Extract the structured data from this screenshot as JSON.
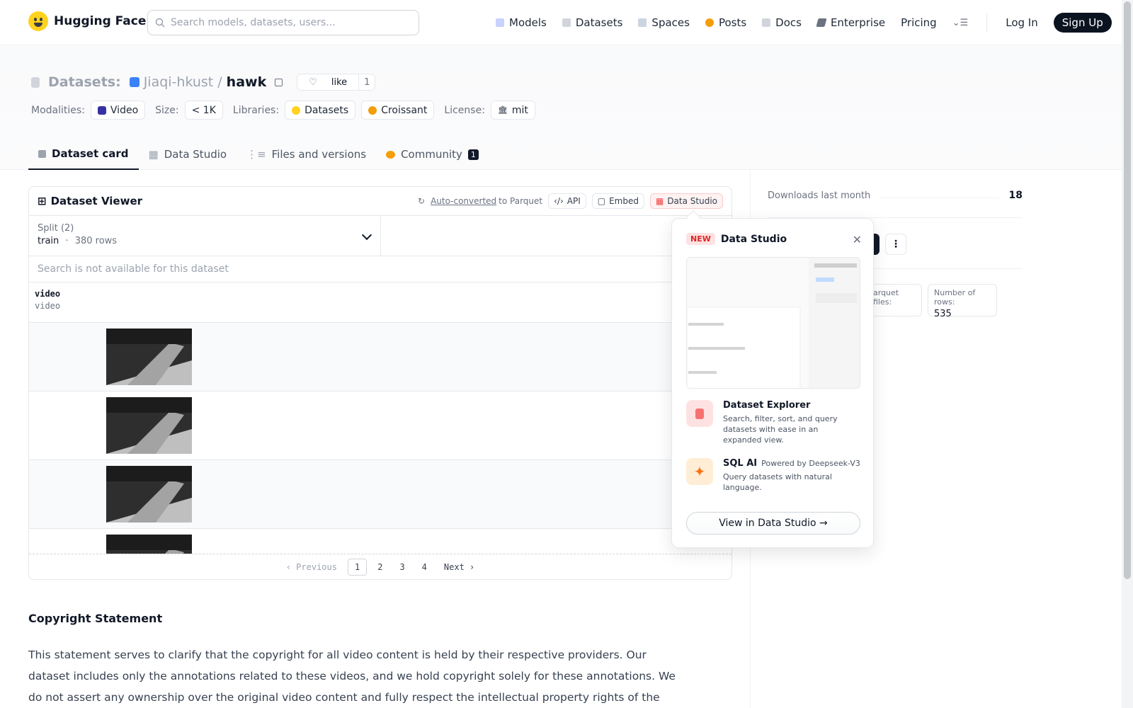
{
  "nav": {
    "brand": "Hugging Face",
    "search_placeholder": "Search models, datasets, users...",
    "links": [
      "Models",
      "Datasets",
      "Spaces",
      "Posts",
      "Docs",
      "Enterprise",
      "Pricing"
    ],
    "login": "Log In",
    "signup": "Sign Up"
  },
  "repo": {
    "kind": "Datasets:",
    "owner": "Jiaqi-hkust",
    "slash": "/",
    "name": "hawk",
    "like_label": "like",
    "like_count": "1"
  },
  "meta": {
    "modalities_label": "Modalities:",
    "modality": "Video",
    "size_label": "Size:",
    "size": "< 1K",
    "libraries_label": "Libraries:",
    "libraries": [
      "Datasets",
      "Croissant"
    ],
    "license_label": "License:",
    "license": "mit"
  },
  "tabs": [
    {
      "label": "Dataset card"
    },
    {
      "label": "Data Studio"
    },
    {
      "label": "Files and versions"
    },
    {
      "label": "Community",
      "badge": "1"
    }
  ],
  "viewer": {
    "title": "Dataset Viewer",
    "auto_converted": "Auto-converted",
    "to_parquet": "to Parquet",
    "api": "API",
    "embed": "Embed",
    "data_studio": "Data Studio",
    "split_label": "Split (2)",
    "split_name": "train",
    "split_dot": "·",
    "split_rows": "380 rows",
    "search_unavailable": "Search is not available for this dataset",
    "column_name": "video",
    "column_type": "video",
    "pager": {
      "previous": "Previous",
      "pages": [
        "1",
        "2",
        "3",
        "4"
      ],
      "current": "1",
      "next": "Next"
    }
  },
  "sidebar": {
    "downloads_label": "Downloads last month",
    "downloads_value": "18",
    "parquet_label": "arquet files:",
    "rows_label": "Number of rows:",
    "rows_value": "535"
  },
  "popover": {
    "new_badge": "NEW",
    "title": "Data Studio",
    "features": [
      {
        "title": "Dataset Explorer",
        "desc": "Search, filter, sort, and query datasets with ease in an expanded view."
      },
      {
        "title": "SQL AI",
        "powered": "Powered by Deepseek-V3",
        "desc": "Query datasets with natural language."
      }
    ],
    "button": "View in Data Studio →"
  },
  "card": {
    "heading": "Copyright Statement",
    "body": "This statement serves to clarify that the copyright for all video content is held by their respective providers. Our dataset includes only the annotations related to these videos, and we hold copyright solely for these annotations. We do not assert any ownership over the original video content and fully respect the intellectual property rights of the original creators and providers."
  },
  "colors": {
    "accent": "#111827",
    "brand_yellow": "#FFD21E",
    "data_studio_red": "#ef4444"
  },
  "icons": [
    "search-icon",
    "models-icon",
    "datasets-icon",
    "spaces-icon",
    "posts-icon",
    "docs-icon",
    "enterprise-icon",
    "menu-icon",
    "heart-icon",
    "copy-icon",
    "video-icon",
    "close-icon",
    "sparkle-icon",
    "database-icon",
    "table-icon"
  ]
}
